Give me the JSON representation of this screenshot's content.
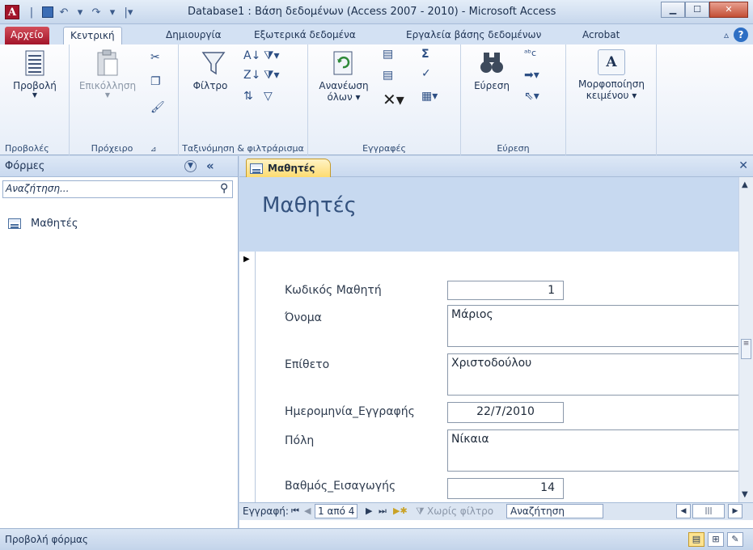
{
  "window": {
    "title": "Database1 : Βάση δεδομένων (Access 2007 - 2010) - Microsoft Access",
    "app_icon_letter": "A",
    "minimize": "▁",
    "maximize": "☐",
    "close": "✕"
  },
  "ribbon_tabs": {
    "file": "Αρχείο",
    "home": "Κεντρική",
    "create": "Δημιουργία",
    "external": "Εξωτερικά δεδομένα",
    "dbtools": "Εργαλεία βάσης δεδομένων",
    "acrobat": "Acrobat"
  },
  "ribbon": {
    "views_group": {
      "view": "Προβολή",
      "label": "Προβολές"
    },
    "clipboard_group": {
      "paste": "Επικόλληση",
      "label": "Πρόχειρο"
    },
    "sort_filter_group": {
      "filter": "Φίλτρο",
      "label": "Ταξινόμηση & φιλτράρισμα"
    },
    "records_group": {
      "refresh_line1": "Ανανέωση",
      "refresh_line2": "όλων ▾",
      "label": "Εγγραφές"
    },
    "find_group": {
      "find": "Εύρεση",
      "label": "Εύρεση"
    },
    "text_format_group": {
      "format_line1": "Μορφοποίηση",
      "format_line2": "κειμένου ▾",
      "icon_letter": "A"
    }
  },
  "nav_pane": {
    "title": "Φόρμες",
    "search_placeholder": "Αναζήτηση...",
    "items": [
      {
        "label": "Μαθητές"
      }
    ]
  },
  "document": {
    "tab_label": "Μαθητές",
    "form_title": "Μαθητές",
    "fields": [
      {
        "label": "Κωδικός Μαθητή",
        "value": "1"
      },
      {
        "label": "Όνομα",
        "value": "Μάριος"
      },
      {
        "label": "Επίθετο",
        "value": "Χριστοδούλου"
      },
      {
        "label": "Ημερομηνία_Εγγραφής",
        "value": "22/7/2010"
      },
      {
        "label": "Πόλη",
        "value": "Νίκαια"
      },
      {
        "label": "Βαθμός_Εισαγωγής",
        "value": "14"
      }
    ]
  },
  "record_nav": {
    "label": "Εγγραφή:",
    "position": "1 από 4",
    "filter": "Χωρίς φίλτρο",
    "search": "Αναζήτηση"
  },
  "status_bar": {
    "text": "Προβολή φόρμας"
  }
}
